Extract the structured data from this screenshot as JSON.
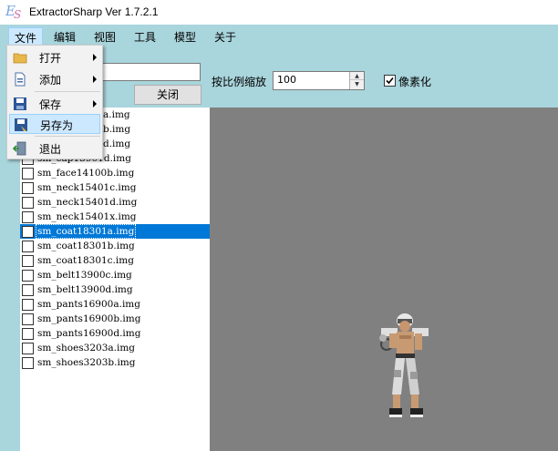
{
  "window": {
    "title": "ExtractorSharp Ver 1.7.2.1",
    "app_icon": "es-logo-icon"
  },
  "menubar": {
    "items": [
      {
        "label": "文件",
        "active": true
      },
      {
        "label": "编辑"
      },
      {
        "label": "视图"
      },
      {
        "label": "工具"
      },
      {
        "label": "模型"
      },
      {
        "label": "关于"
      }
    ]
  },
  "file_menu": {
    "items": [
      {
        "label": "打开",
        "icon": "folder-icon",
        "submenu": true
      },
      {
        "label": "添加",
        "icon": "add-file-icon",
        "submenu": true
      },
      {
        "label": "保存",
        "icon": "save-icon",
        "submenu": true
      },
      {
        "label": "另存为",
        "icon": "save-as-icon",
        "submenu": false,
        "highlighted": true
      },
      {
        "label": "退出",
        "icon": "exit-icon",
        "submenu": false
      }
    ]
  },
  "toolbar": {
    "search_value": "",
    "close_label": "关闭",
    "scale_label": "按比例缩放",
    "scale_value": "100",
    "pixelate_label": "像素化",
    "pixelate_checked": true
  },
  "file_list": {
    "items": [
      {
        "name": "a.img",
        "partial": true
      },
      {
        "name": "b.img",
        "partial": true
      },
      {
        "name": "d.img",
        "partial": true
      },
      {
        "name": "sm_cap13901d.img",
        "partial": true
      },
      {
        "name": "sm_face14100b.img"
      },
      {
        "name": "sm_neck15401c.img"
      },
      {
        "name": "sm_neck15401d.img"
      },
      {
        "name": "sm_neck15401x.img"
      },
      {
        "name": "sm_coat18301a.img",
        "selected": true
      },
      {
        "name": "sm_coat18301b.img"
      },
      {
        "name": "sm_coat18301c.img"
      },
      {
        "name": "sm_belt13900c.img"
      },
      {
        "name": "sm_belt13900d.img"
      },
      {
        "name": "sm_pants16900a.img"
      },
      {
        "name": "sm_pants16900b.img"
      },
      {
        "name": "sm_pants16900d.img"
      },
      {
        "name": "sm_shoes3203a.img"
      },
      {
        "name": "sm_shoes3203b.img"
      }
    ]
  },
  "canvas": {
    "background": "#808080",
    "sprite": "character-sprite"
  },
  "colors": {
    "surface": "#a9d5dc",
    "selection": "#0078d7",
    "menu_highlight": "#cce8ff"
  }
}
